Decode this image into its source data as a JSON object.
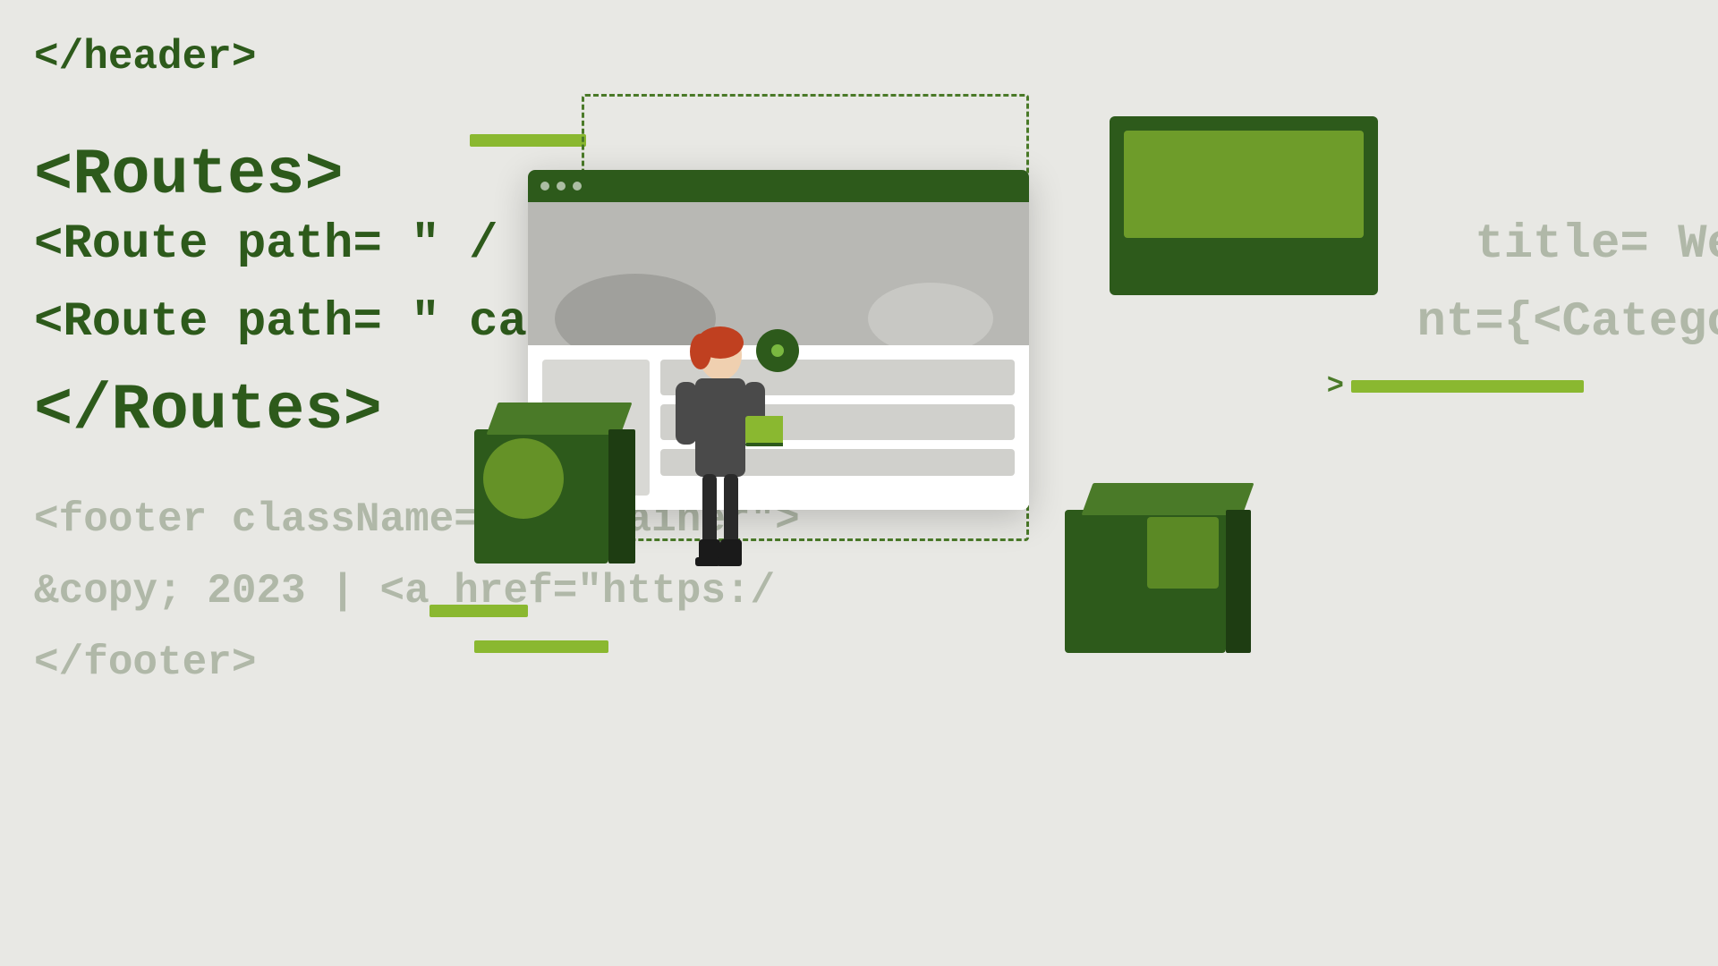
{
  "background_color": "#e8e8e4",
  "code": {
    "line1": "</header>",
    "line2": "<Routes>",
    "line3": "<Route path= \" /",
    "line4": "<Route path= \" ca",
    "line5": "</Routes>",
    "line6_fade": "<footer className= \"container\">",
    "line7_fade": "&copy; 2023 | <a href=\"https:/",
    "line8_fade": "</footer>",
    "line9_fade": "title= We",
    "line10_fade": "nt={<Catego",
    "chevron": ">",
    "arrow_label": ""
  },
  "illustration": {
    "browser_title": "Browser Window",
    "dashed_box_label": "Selection",
    "pin_label": "Location Pin",
    "accent_bars": [
      "top bar",
      "bottom bar",
      "right bar"
    ],
    "boxes_3d": [
      "box1",
      "box2",
      "box3"
    ]
  },
  "colors": {
    "dark_green": "#2d5a1b",
    "medium_green": "#4a7a28",
    "light_green": "#8ab830",
    "accent_green": "#7ab840",
    "bg": "#e8e8e4",
    "code_fade": "#b0b8a8"
  }
}
